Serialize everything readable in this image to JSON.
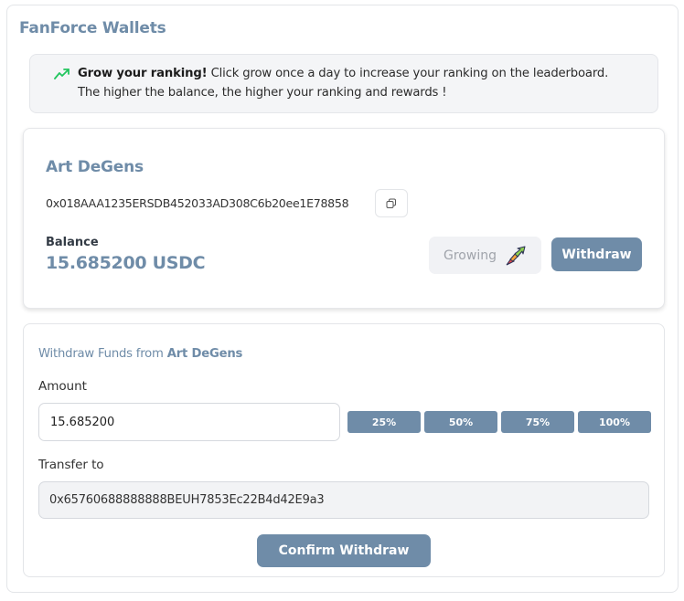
{
  "page": {
    "title": "FanForce Wallets"
  },
  "info": {
    "icon": "trending-up-icon",
    "bold": "Grow your ranking!",
    "line1_rest": " Click grow once a day to increase your ranking on the leaderboard.",
    "line2": "The higher the balance, the higher your ranking and rewards !"
  },
  "wallet": {
    "name": "Art DeGens",
    "address": "0x018AAA1235ERSDB452033AD308C6b20ee1E78858",
    "copy_icon": "copy-icon",
    "balance_label": "Balance",
    "balance_value": "15.685200 USDC",
    "growing_label": "Growing",
    "growing_icon": "rocket-arrow-icon",
    "withdraw_label": "Withdraw"
  },
  "withdraw_form": {
    "title_prefix": "Withdraw Funds from ",
    "title_wallet": "Art DeGens",
    "amount_label": "Amount",
    "amount_value": "15.685200",
    "percent_buttons": [
      "25%",
      "50%",
      "75%",
      "100%"
    ],
    "transfer_label": "Transfer to",
    "transfer_value": "0x65760688888888BEUH7853Ec22B4d42E9a3",
    "confirm_label": "Confirm Withdraw"
  },
  "colors": {
    "accent": "#6f8ca8",
    "trend_green": "#22c55e"
  }
}
